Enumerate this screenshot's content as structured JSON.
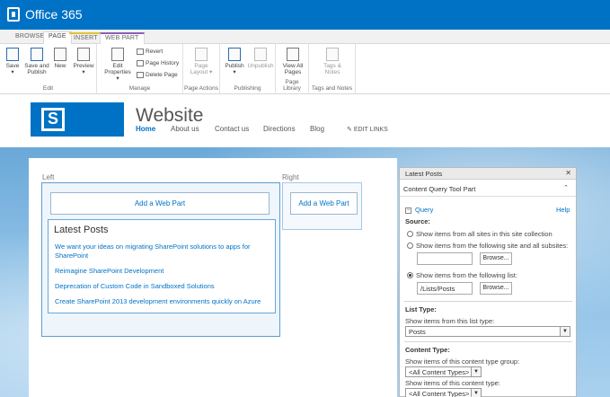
{
  "suitebar": {
    "title": "Office 365"
  },
  "ribbon": {
    "tabs": [
      "BROWSE",
      "PAGE",
      "INSERT",
      "WEB PART"
    ],
    "groups": {
      "edit": {
        "label": "Edit",
        "save": "Save",
        "save_publish_1": "Save and",
        "save_publish_2": "Publish",
        "new": "New",
        "preview": "Preview"
      },
      "manage": {
        "label": "Manage",
        "edit_props_1": "Edit",
        "edit_props_2": "Properties",
        "revert": "Revert",
        "history": "Page History",
        "delete": "Delete Page"
      },
      "page_actions": {
        "label": "Page Actions",
        "layout_1": "Page",
        "layout_2": "Layout"
      },
      "publishing": {
        "label": "Publishing",
        "publish": "Publish",
        "unpublish": "Unpublish"
      },
      "page_library": {
        "label": "Page Library",
        "view_all_1": "View All",
        "view_all_2": "Pages"
      },
      "tags": {
        "label": "Tags and Notes",
        "tags_1": "Tags &",
        "tags_2": "Notes"
      }
    }
  },
  "site": {
    "title": "Website",
    "nav": [
      "Home",
      "About us",
      "Contact us",
      "Directions",
      "Blog"
    ],
    "edit_links": "EDIT LINKS"
  },
  "zones": {
    "left_label": "Left",
    "right_label": "Right",
    "add_web_part": "Add a Web Part"
  },
  "latest_posts": {
    "title": "Latest Posts",
    "links": [
      "We want your ideas on migrating SharePoint solutions to apps for SharePoint",
      "Reimagine SharePoint Development",
      "Deprecation of Custom Code in Sandboxed Solutions",
      "Create SharePoint 2013 development environments quickly on Azure"
    ]
  },
  "toolpane": {
    "header": "Latest Posts",
    "close": "✕",
    "subheader": "Content Query Tool Part",
    "collapse": "⌃",
    "query": "Query",
    "help": "Help",
    "source_label": "Source:",
    "source_opt1": "Show items from all sites in this site collection",
    "source_opt2": "Show items from the following site and all subsites:",
    "source_opt3": "Show items from the following list:",
    "browse": "Browse...",
    "list_value": "/Lists/Posts",
    "list_type_label": "List Type:",
    "list_type_desc": "Show items from this list type:",
    "list_type_value": "Posts",
    "content_type_label": "Content Type:",
    "ct_group_desc": "Show items of this content type group:",
    "ct_group_value": "<All Content Types>",
    "ct_desc": "Show items of this content type:",
    "ct_value": "<All Content Types>"
  }
}
